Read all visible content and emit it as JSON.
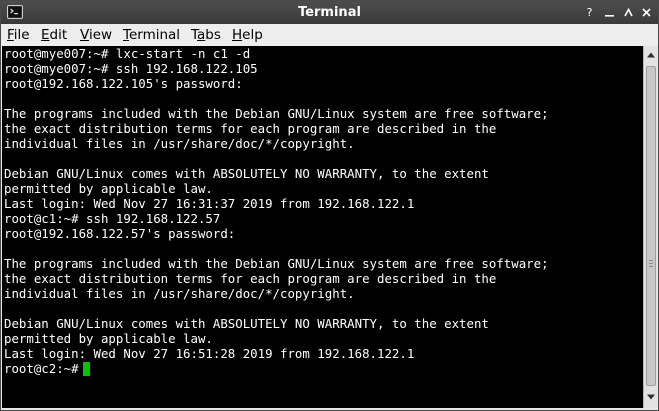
{
  "window": {
    "title": "Terminal",
    "icon": "terminal-app-icon",
    "controls": {
      "help": "?",
      "help_icon": "help-icon",
      "minimize_icon": "minimize-icon",
      "maximize_icon": "maximize-icon",
      "close_icon": "close-icon"
    }
  },
  "menubar": {
    "items": [
      {
        "mnemonic": "F",
        "rest": "ile"
      },
      {
        "mnemonic": "E",
        "rest": "dit"
      },
      {
        "mnemonic": "V",
        "rest": "iew"
      },
      {
        "mnemonic": "T",
        "rest": "erminal"
      },
      {
        "pre": "T",
        "mnemonic": "a",
        "rest": "bs"
      },
      {
        "mnemonic": "H",
        "rest": "elp"
      }
    ]
  },
  "terminal": {
    "lines": [
      "root@mye007:~# lxc-start -n c1 -d",
      "root@mye007:~# ssh 192.168.122.105",
      "root@192.168.122.105's password:",
      "",
      "The programs included with the Debian GNU/Linux system are free software;",
      "the exact distribution terms for each program are described in the",
      "individual files in /usr/share/doc/*/copyright.",
      "",
      "Debian GNU/Linux comes with ABSOLUTELY NO WARRANTY, to the extent",
      "permitted by applicable law.",
      "Last login: Wed Nov 27 16:31:37 2019 from 192.168.122.1",
      "root@c1:~# ssh 192.168.122.57",
      "root@192.168.122.57's password:",
      "",
      "The programs included with the Debian GNU/Linux system are free software;",
      "the exact distribution terms for each program are described in the",
      "individual files in /usr/share/doc/*/copyright.",
      "",
      "Debian GNU/Linux comes with ABSOLUTELY NO WARRANTY, to the extent",
      "permitted by applicable law.",
      "Last login: Wed Nov 27 16:51:28 2019 from 192.168.122.1",
      "root@c2:~#"
    ],
    "cursor_color": "#00c800",
    "background": "#000000",
    "foreground": "#ffffff"
  },
  "scrollbar": {
    "up_icon": "scroll-up-arrow-icon",
    "down_icon": "scroll-down-arrow-icon"
  }
}
